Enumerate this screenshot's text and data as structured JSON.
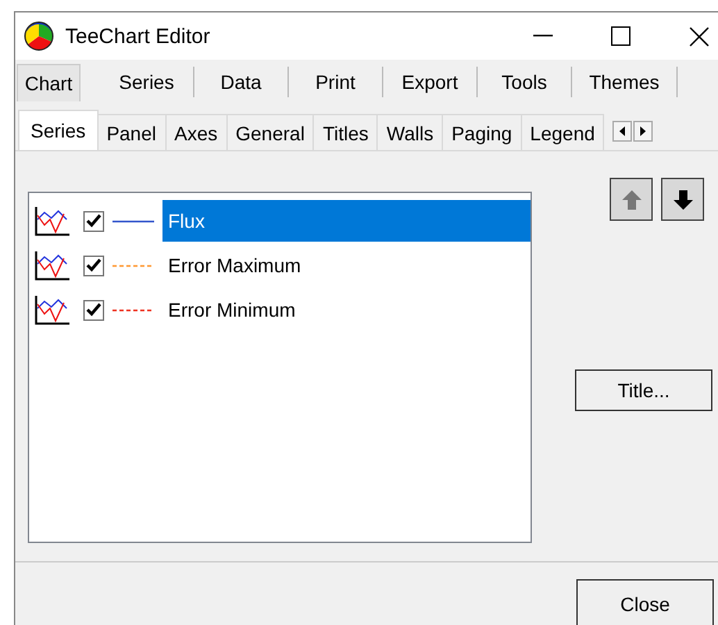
{
  "window": {
    "title": "TeeChart Editor"
  },
  "main_tabs": [
    {
      "label": "Chart",
      "selected": true
    },
    {
      "label": "Series",
      "selected": false
    },
    {
      "label": "Data",
      "selected": false
    },
    {
      "label": "Print",
      "selected": false
    },
    {
      "label": "Export",
      "selected": false
    },
    {
      "label": "Tools",
      "selected": false
    },
    {
      "label": "Themes",
      "selected": false
    }
  ],
  "sub_tabs": [
    {
      "label": "Series",
      "selected": true
    },
    {
      "label": "Panel",
      "selected": false
    },
    {
      "label": "Axes",
      "selected": false
    },
    {
      "label": "General",
      "selected": false
    },
    {
      "label": "Titles",
      "selected": false
    },
    {
      "label": "Walls",
      "selected": false
    },
    {
      "label": "Paging",
      "selected": false
    },
    {
      "label": "Legend",
      "selected": false
    }
  ],
  "series": [
    {
      "name": "Flux",
      "checked": true,
      "selected": true,
      "kind": "solid",
      "color": "#3355cc"
    },
    {
      "name": "Error Maximum",
      "checked": true,
      "selected": false,
      "kind": "dashed",
      "color": "#ff9933"
    },
    {
      "name": "Error Minimum",
      "checked": true,
      "selected": false,
      "kind": "dashed",
      "color": "#ee3322"
    }
  ],
  "move_buttons": [
    {
      "kind": "up",
      "disabled": true
    },
    {
      "kind": "down",
      "disabled": false
    }
  ],
  "title_button": "Title...",
  "close_button": "Close"
}
